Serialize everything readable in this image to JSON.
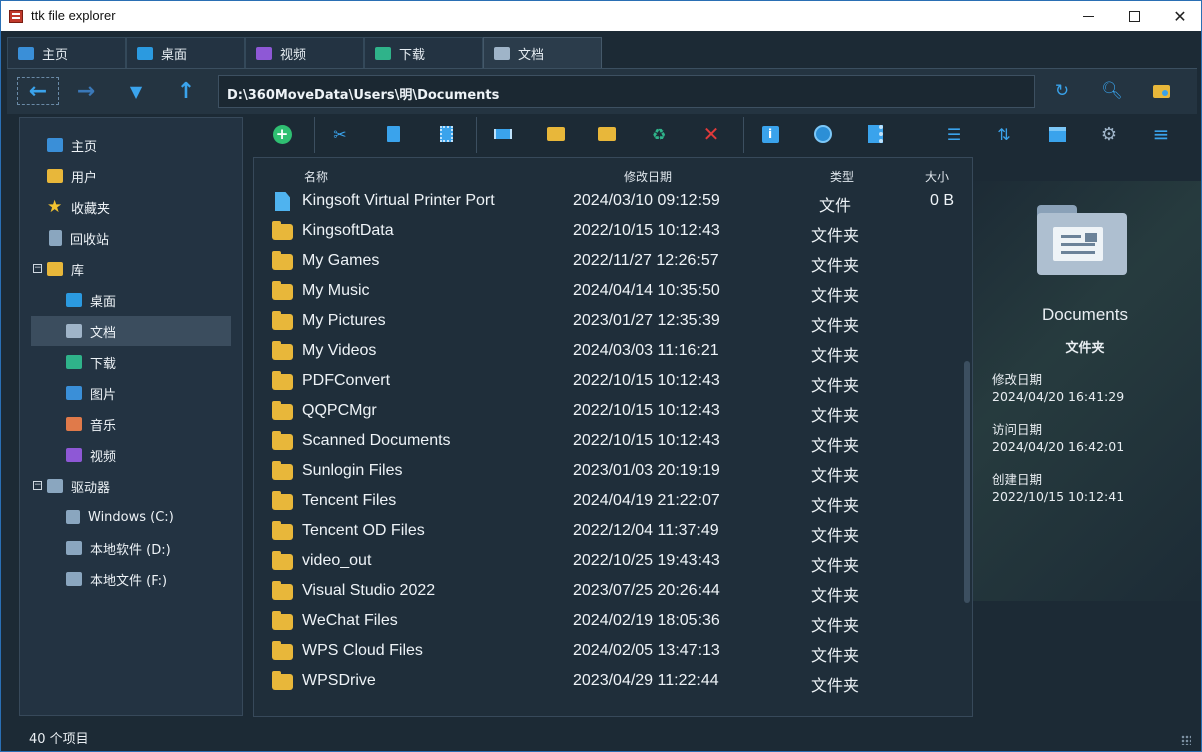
{
  "window": {
    "title": "ttk file explorer"
  },
  "tabs": [
    {
      "label": "主页",
      "icon": "home-icon",
      "color": "#3a8fd8"
    },
    {
      "label": "桌面",
      "icon": "desktop-icon",
      "color": "#2b9ae0"
    },
    {
      "label": "视频",
      "icon": "video-icon",
      "color": "#8e58d6"
    },
    {
      "label": "下载",
      "icon": "download-icon",
      "color": "#2fb38a"
    },
    {
      "label": "文档",
      "icon": "documents-icon",
      "color": "#9fb4c8"
    }
  ],
  "nav": {
    "address": "D:\\360MoveData\\Users\\明\\Documents"
  },
  "sidebar": {
    "items": [
      {
        "label": "主页",
        "icon": "home-icon",
        "color": "#3a8fd8"
      },
      {
        "label": "用户",
        "icon": "user-folder-icon",
        "color": "#e8b73a"
      },
      {
        "label": "收藏夹",
        "icon": "star-icon",
        "color": "#f2c230"
      },
      {
        "label": "回收站",
        "icon": "recycle-bin-icon",
        "color": "#8aa6bf"
      },
      {
        "label": "库",
        "icon": "library-icon",
        "color": "#e8b73a"
      },
      {
        "label": "桌面",
        "icon": "desktop-icon",
        "color": "#2b9ae0"
      },
      {
        "label": "文档",
        "icon": "documents-icon",
        "color": "#9fb4c8"
      },
      {
        "label": "下载",
        "icon": "download-icon",
        "color": "#2fb38a"
      },
      {
        "label": "图片",
        "icon": "pictures-icon",
        "color": "#3a8fd8"
      },
      {
        "label": "音乐",
        "icon": "music-icon",
        "color": "#e07a4a"
      },
      {
        "label": "视频",
        "icon": "video-icon",
        "color": "#8e58d6"
      },
      {
        "label": "驱动器",
        "icon": "drive-icon",
        "color": "#8aa6bf"
      },
      {
        "label": "Windows (C:)",
        "icon": "windows-drive-icon",
        "color": "#8aa6bf"
      },
      {
        "label": "本地软件 (D:)",
        "icon": "drive-icon",
        "color": "#8aa6bf"
      },
      {
        "label": "本地文件 (F:)",
        "icon": "drive-icon",
        "color": "#8aa6bf"
      }
    ]
  },
  "filelist": {
    "headers": {
      "name": "名称",
      "modified": "修改日期",
      "type": "类型",
      "size": "大小"
    },
    "rows": [
      {
        "name": "Kingsoft Virtual Printer Port",
        "modified": "2024/03/10 09:12:59",
        "type": "文件",
        "size": "0 B",
        "kind": "file"
      },
      {
        "name": "KingsoftData",
        "modified": "2022/10/15 10:12:43",
        "type": "文件夹",
        "size": "",
        "kind": "folder"
      },
      {
        "name": "My Games",
        "modified": "2022/11/27 12:26:57",
        "type": "文件夹",
        "size": "",
        "kind": "folder"
      },
      {
        "name": "My Music",
        "modified": "2024/04/14 10:35:50",
        "type": "文件夹",
        "size": "",
        "kind": "folder"
      },
      {
        "name": "My Pictures",
        "modified": "2023/01/27 12:35:39",
        "type": "文件夹",
        "size": "",
        "kind": "folder"
      },
      {
        "name": "My Videos",
        "modified": "2024/03/03 11:16:21",
        "type": "文件夹",
        "size": "",
        "kind": "folder"
      },
      {
        "name": "PDFConvert",
        "modified": "2022/10/15 10:12:43",
        "type": "文件夹",
        "size": "",
        "kind": "folder"
      },
      {
        "name": "QQPCMgr",
        "modified": "2022/10/15 10:12:43",
        "type": "文件夹",
        "size": "",
        "kind": "folder"
      },
      {
        "name": "Scanned Documents",
        "modified": "2022/10/15 10:12:43",
        "type": "文件夹",
        "size": "",
        "kind": "folder"
      },
      {
        "name": "Sunlogin Files",
        "modified": "2023/01/03 20:19:19",
        "type": "文件夹",
        "size": "",
        "kind": "folder"
      },
      {
        "name": "Tencent Files",
        "modified": "2024/04/19 21:22:07",
        "type": "文件夹",
        "size": "",
        "kind": "folder"
      },
      {
        "name": "Tencent OD Files",
        "modified": "2022/12/04 11:37:49",
        "type": "文件夹",
        "size": "",
        "kind": "folder"
      },
      {
        "name": "video_out",
        "modified": "2022/10/25 19:43:43",
        "type": "文件夹",
        "size": "",
        "kind": "folder"
      },
      {
        "name": "Visual Studio 2022",
        "modified": "2023/07/25 20:26:44",
        "type": "文件夹",
        "size": "",
        "kind": "folder"
      },
      {
        "name": "WeChat Files",
        "modified": "2024/02/19 18:05:36",
        "type": "文件夹",
        "size": "",
        "kind": "folder"
      },
      {
        "name": "WPS Cloud Files",
        "modified": "2024/02/05 13:47:13",
        "type": "文件夹",
        "size": "",
        "kind": "folder"
      },
      {
        "name": "WPSDrive",
        "modified": "2023/04/29 11:22:44",
        "type": "文件夹",
        "size": "",
        "kind": "folder"
      }
    ]
  },
  "preview": {
    "name": "Documents",
    "type": "文件夹",
    "modified_label": "修改日期",
    "modified": "2024/04/20 16:41:29",
    "accessed_label": "访问日期",
    "accessed": "2024/04/20 16:42:01",
    "created_label": "创建日期",
    "created": "2022/10/15 10:12:41"
  },
  "status": {
    "text": "40 个项目"
  },
  "theme": {
    "accent": "#39a2ea",
    "folder": "#e8b73a",
    "background": "#1c2a35"
  }
}
